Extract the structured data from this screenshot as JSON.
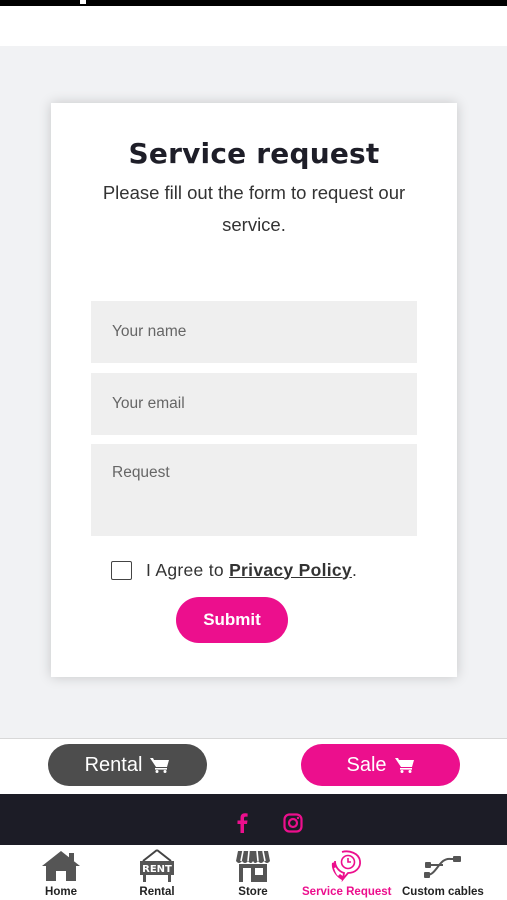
{
  "form": {
    "title": "Service request",
    "subtitle": "Please fill out the form to request our service.",
    "name_placeholder": "Your name",
    "email_placeholder": "Your email",
    "request_placeholder": "Request",
    "agree_prefix": "I Agree to ",
    "privacy_link": "Privacy Policy",
    "agree_suffix": ".",
    "submit_label": "Submit"
  },
  "actions": {
    "rental_label": "Rental",
    "sale_label": "Sale"
  },
  "social": {
    "icons": [
      "facebook-icon",
      "instagram-icon"
    ],
    "color": "#ec0f8d"
  },
  "bottom_nav": {
    "items": [
      {
        "label": "Home",
        "icon": "home-icon",
        "active": false
      },
      {
        "label": "Rental",
        "icon": "rent-sign-icon",
        "active": false
      },
      {
        "label": "Store",
        "icon": "store-icon",
        "active": false
      },
      {
        "label": "Service Request",
        "icon": "service-request-icon",
        "active": true
      },
      {
        "label": "Custom cables",
        "icon": "cables-icon",
        "active": false
      }
    ]
  },
  "colors": {
    "accent": "#ec0f8d",
    "dark": "#4d4d4d",
    "footer": "#1c1c26",
    "background": "#f1f2f4"
  }
}
